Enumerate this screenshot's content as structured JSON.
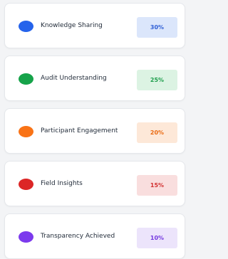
{
  "items": [
    {
      "label": "Knowledge Sharing",
      "value": "30%",
      "dot_color": "#2563eb",
      "badge_bg": "#dbe6fb",
      "badge_color": "#2f5fd6"
    },
    {
      "label": "Audit Understanding",
      "value": "25%",
      "dot_color": "#16a34a",
      "badge_bg": "#dcf3e3",
      "badge_color": "#1e9e4c"
    },
    {
      "label": "Participant Engagement",
      "value": "20%",
      "dot_color": "#f97316",
      "badge_bg": "#fde8d8",
      "badge_color": "#ea6a12"
    },
    {
      "label": "Field Insights",
      "value": "15%",
      "dot_color": "#dc2626",
      "badge_bg": "#f9dede",
      "badge_color": "#d23030"
    },
    {
      "label": "Transparency Achieved",
      "value": "10%",
      "dot_color": "#7c3aed",
      "badge_bg": "#ece4fb",
      "badge_color": "#7438e0"
    }
  ]
}
